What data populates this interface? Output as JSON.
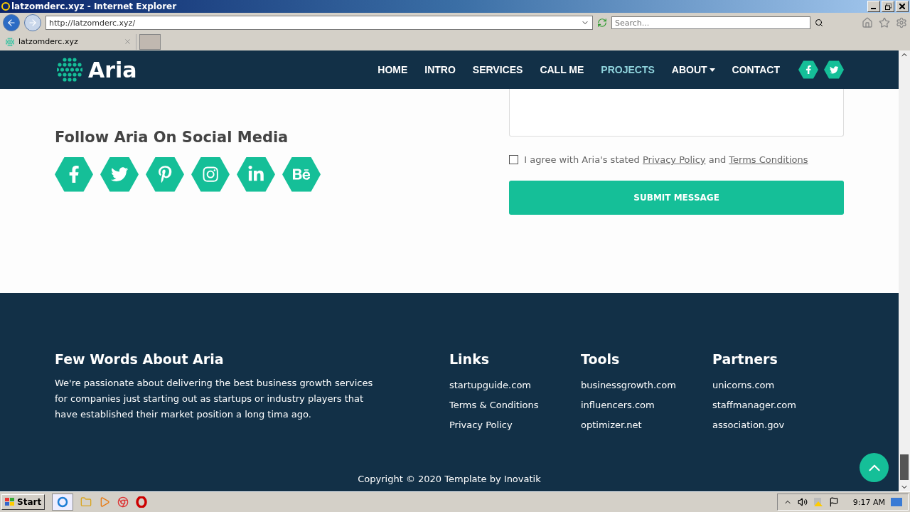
{
  "window": {
    "title": "latzomderc.xyz - Internet Explorer"
  },
  "address_bar": {
    "url": "http://latzomderc.xyz/",
    "search_placeholder": "Search..."
  },
  "tabs": [
    {
      "label": "latzomderc.xyz",
      "selected": true
    }
  ],
  "navbar": {
    "logo": "Aria",
    "items": [
      {
        "label": "HOME",
        "selected": false,
        "dropdown": false
      },
      {
        "label": "INTRO",
        "selected": false,
        "dropdown": false
      },
      {
        "label": "SERVICES",
        "selected": false,
        "dropdown": false
      },
      {
        "label": "CALL ME",
        "selected": false,
        "dropdown": false
      },
      {
        "label": "PROJECTS",
        "selected": true,
        "dropdown": false
      },
      {
        "label": "ABOUT",
        "selected": false,
        "dropdown": true
      },
      {
        "label": "CONTACT",
        "selected": false,
        "dropdown": false
      }
    ]
  },
  "social": {
    "heading": "Follow Aria On Social Media"
  },
  "form": {
    "agree": {
      "checked": false,
      "prefix": "I agree with Aria's stated",
      "link_1": "Privacy Policy",
      "middle": "and",
      "link_2": "Terms Conditions"
    },
    "submit": "SUBMIT MESSAGE"
  },
  "footer": {
    "about": {
      "title": "Few Words About Aria",
      "text": "We're passionate about delivering the best business growth services for companies just starting out as startups or industry players that have established their market position a long tima ago."
    },
    "columns": [
      {
        "title": "Links",
        "links": [
          "startupguide.com",
          "Terms & Conditions",
          "Privacy Policy"
        ]
      },
      {
        "title": "Tools",
        "links": [
          "businessgrowth.com",
          "influencers.com",
          "optimizer.net"
        ]
      },
      {
        "title": "Partners",
        "links": [
          "unicorns.com",
          "staffmanager.com",
          "association.gov"
        ]
      }
    ],
    "copyright": "Copyright © 2020 Template by Inovatik"
  },
  "taskbar": {
    "start": "Start",
    "clock": "9:17 AM"
  }
}
